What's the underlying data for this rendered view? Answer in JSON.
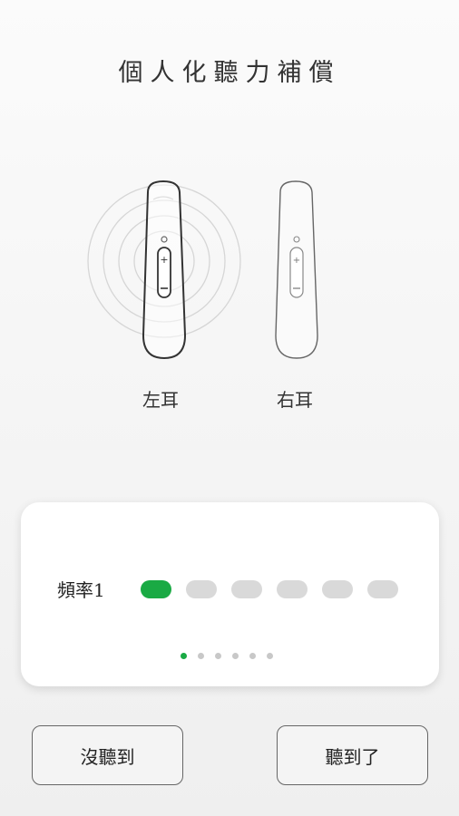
{
  "page": {
    "title": "個人化聽力補償"
  },
  "ears": {
    "left_label": "左耳",
    "right_label": "右耳",
    "active": "left"
  },
  "frequency": {
    "label": "頻率1",
    "levels": 6,
    "active_level": 1,
    "pages": 6,
    "active_page": 1,
    "accent_color": "#1aaa44",
    "inactive_color": "#d9d9d9"
  },
  "actions": {
    "not_heard_label": "沒聽到",
    "heard_label": "聽到了"
  }
}
